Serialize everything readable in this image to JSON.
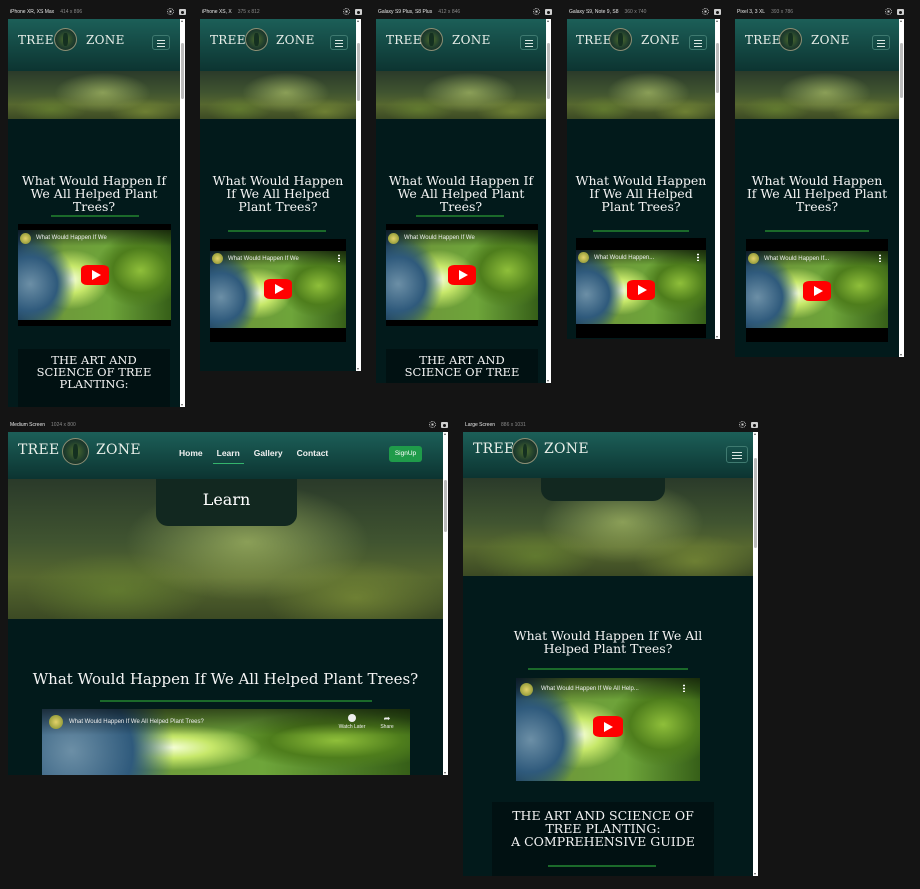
{
  "site": {
    "brand_left": "TREE",
    "brand_right": "ZONE"
  },
  "content": {
    "hero_heading": "Learn",
    "video_title": "What Would Happen If We All Helped Plant Trees?",
    "video_title_short_1": "What Would Happen If We",
    "video_title_short_2": "What Would Happen...",
    "video_title_short_3": "What Would Happen If...",
    "video_title_short_4": "What Would Happen If We All Help...",
    "card_line1": "THE ART AND SCIENCE OF",
    "card_line2": "TREE PLANTING:",
    "card_line3": "A COMPREHENSIVE GUIDE",
    "card_sm_1": "THE ART AND",
    "card_sm_2": "SCIENCE OF TREE",
    "card_sm_3": "PLANTING:",
    "watch_later": "Watch Later",
    "share": "Share"
  },
  "nav": {
    "home": "Home",
    "learn": "Learn",
    "gallery": "Gallery",
    "contact": "Contact",
    "signup": "SignUp",
    "active": "Learn"
  },
  "devices": [
    {
      "name": "iPhone XR, XS Max",
      "size": "414 x 896"
    },
    {
      "name": "iPhone XS, X",
      "size": "375 x 812"
    },
    {
      "name": "Galaxy S9 Plus, S8 Plus",
      "size": "412 x 846"
    },
    {
      "name": "Galaxy S9, Note 9, S8",
      "size": "360 x 740"
    },
    {
      "name": "Pixel 3, 3 XL",
      "size": "393 x 786"
    },
    {
      "name": "Medium Screen",
      "size": "1024 x 800"
    },
    {
      "name": "Large Screen",
      "size": "886 x 1031"
    }
  ],
  "colors": {
    "header": "#1c5f58",
    "background": "#021a1b",
    "accent": "#1f9b4a",
    "underline": "#1b6a2a",
    "youtube": "#ff0000"
  }
}
